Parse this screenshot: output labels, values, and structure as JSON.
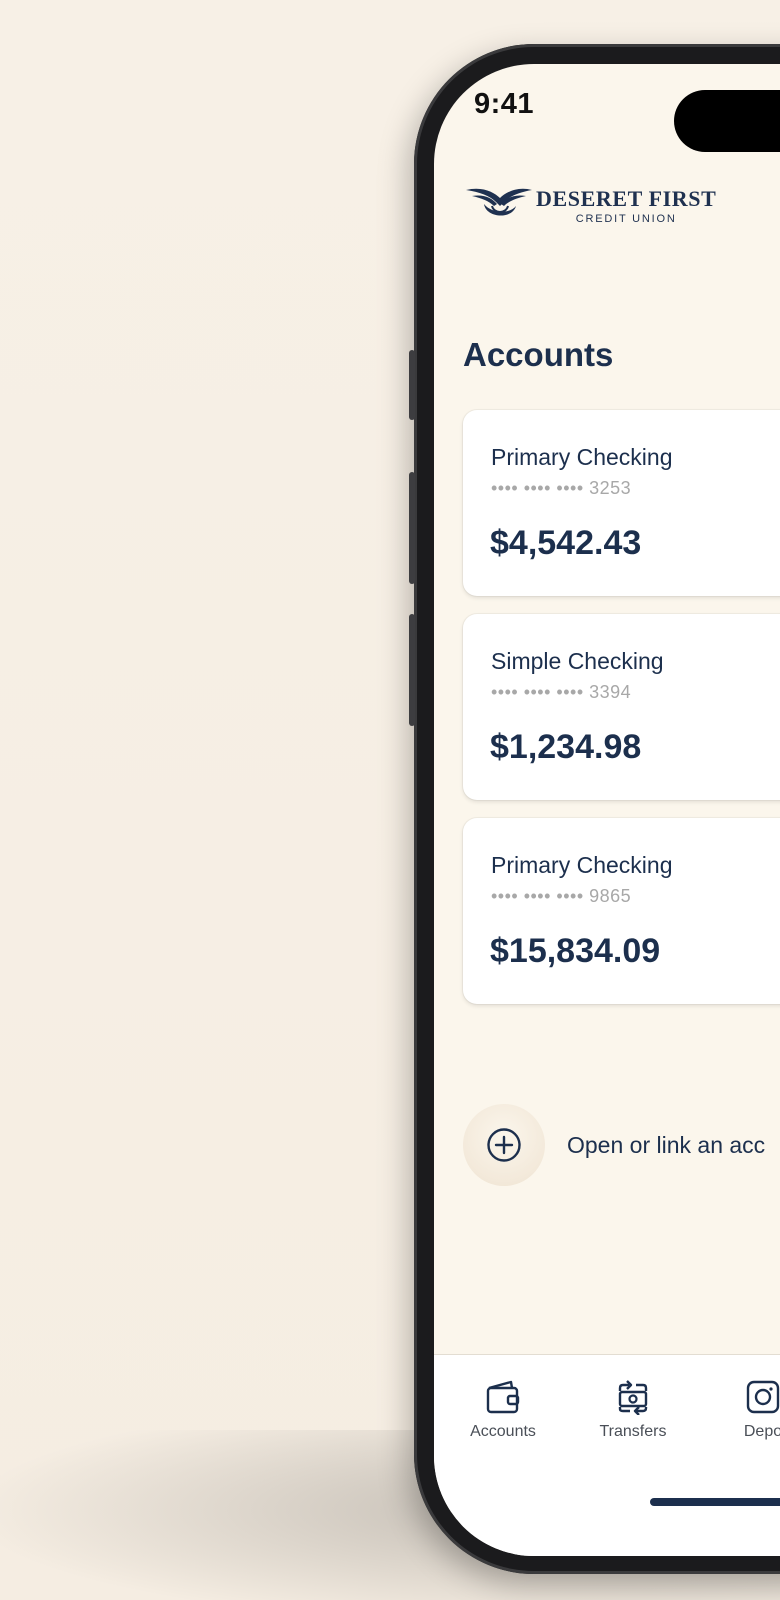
{
  "status_bar": {
    "time": "9:41"
  },
  "brand": {
    "name": "DESERET FIRST",
    "subtitle": "CREDIT UNION",
    "color": "#1f3150"
  },
  "accounts_section": {
    "title": "Accounts",
    "accounts": [
      {
        "name": "Primary Checking",
        "masked_number": "•••• •••• •••• 3253",
        "balance": "$4,542.43"
      },
      {
        "name": "Simple Checking",
        "masked_number": "•••• •••• •••• 3394",
        "balance": "$1,234.98"
      },
      {
        "name": "Primary Checking",
        "masked_number": "•••• •••• •••• 9865",
        "balance": "$15,834.09"
      }
    ],
    "open_link_label": "Open or link an acc"
  },
  "tab_bar": {
    "tabs": [
      {
        "label": "Accounts",
        "icon": "wallet-icon"
      },
      {
        "label": "Transfers",
        "icon": "transfer-icon"
      },
      {
        "label": "Depo",
        "icon": "deposit-icon"
      }
    ]
  },
  "colors": {
    "background": "#f6efe5",
    "screen": "#fbf6ec",
    "primary_text": "#1c2f4d",
    "muted_text": "#a8a8a8"
  }
}
